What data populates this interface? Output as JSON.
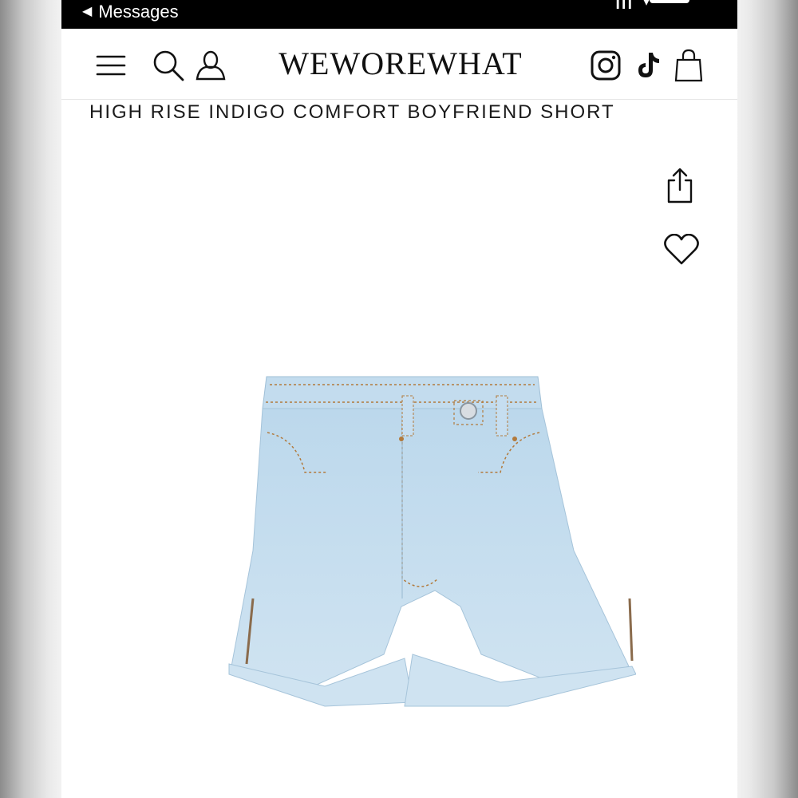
{
  "status_bar": {
    "back_label": "Messages",
    "back_arrow": "◀",
    "signal_text": "ııı",
    "wifi_icon": "wifi-icon"
  },
  "header": {
    "logo": "WEWOREWHAT",
    "icons": [
      "menu-icon",
      "search-icon",
      "account-icon",
      "instagram-icon",
      "tiktok-icon",
      "shopping-bag-icon"
    ]
  },
  "product": {
    "title": "HIGH RISE INDIGO COMFORT BOYFRIEND SHORT",
    "image_description_icon": "denim-shorts-image"
  },
  "actions": {
    "share_icon": "share-icon",
    "wishlist_icon": "heart-icon"
  },
  "colors": {
    "status_bar": "#000000",
    "background": "#ffffff",
    "text": "#111111",
    "denim": "#c4dced",
    "stitch": "#b27a3c"
  }
}
